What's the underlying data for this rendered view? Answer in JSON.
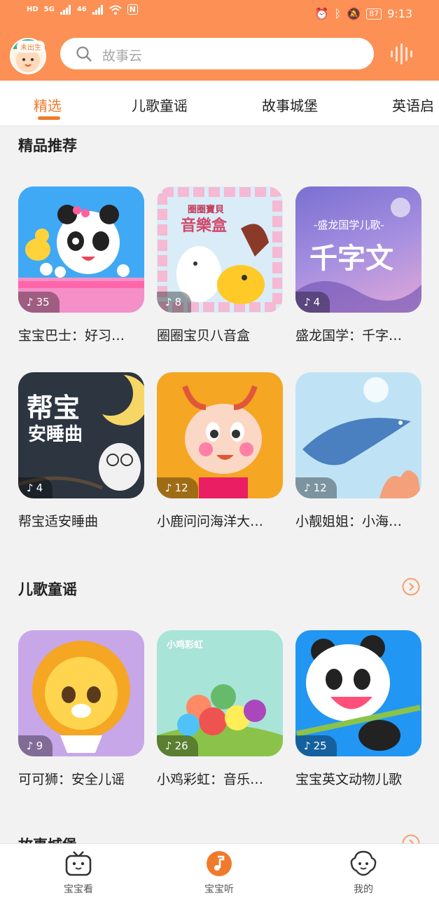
{
  "status_bar": {
    "left_labels": [
      "HD",
      "5G",
      "46",
      "N"
    ],
    "battery": "87",
    "time": "9:13"
  },
  "header": {
    "avatar_badge": "未出生",
    "search_placeholder": "故事云"
  },
  "tabs": [
    "精选",
    "儿歌童谣",
    "故事城堡",
    "英语启"
  ],
  "sections": [
    {
      "title": "精品推荐",
      "items": [
        {
          "title": "宝宝巴士：好习…",
          "count": "35"
        },
        {
          "title": "圈圈宝贝八音盒",
          "count": "8"
        },
        {
          "title": "盛龙国学：千字…",
          "count": "4"
        },
        {
          "title": "帮宝适安睡曲",
          "count": "4"
        },
        {
          "title": "小鹿问问海洋大…",
          "count": "12"
        },
        {
          "title": "小靓姐姐：小海…",
          "count": "12"
        }
      ]
    },
    {
      "title": "儿歌童谣",
      "items": [
        {
          "title": "可可狮：安全儿谣",
          "count": "9"
        },
        {
          "title": "小鸡彩虹：音乐…",
          "count": "26"
        },
        {
          "title": "宝宝英文动物儿歌",
          "count": "25"
        }
      ]
    },
    {
      "title": "故事城堡"
    }
  ],
  "cover_texts": {
    "c2_top": "圈圈寶貝",
    "c2_main": "音樂盒",
    "c3_top": "-盛龙国学儿歌-",
    "c3_main": "千字文",
    "c4_line1": "帮宝",
    "c4_line2": "安睡曲",
    "c8_text": "小鸡彩虹"
  },
  "bottom_nav": [
    {
      "label": "宝宝看",
      "icon": "tv-icon"
    },
    {
      "label": "宝宝听",
      "icon": "music-note-icon"
    },
    {
      "label": "我的",
      "icon": "face-icon"
    }
  ],
  "colors": {
    "brand": "#fd9054",
    "accent": "#f07a2c"
  }
}
